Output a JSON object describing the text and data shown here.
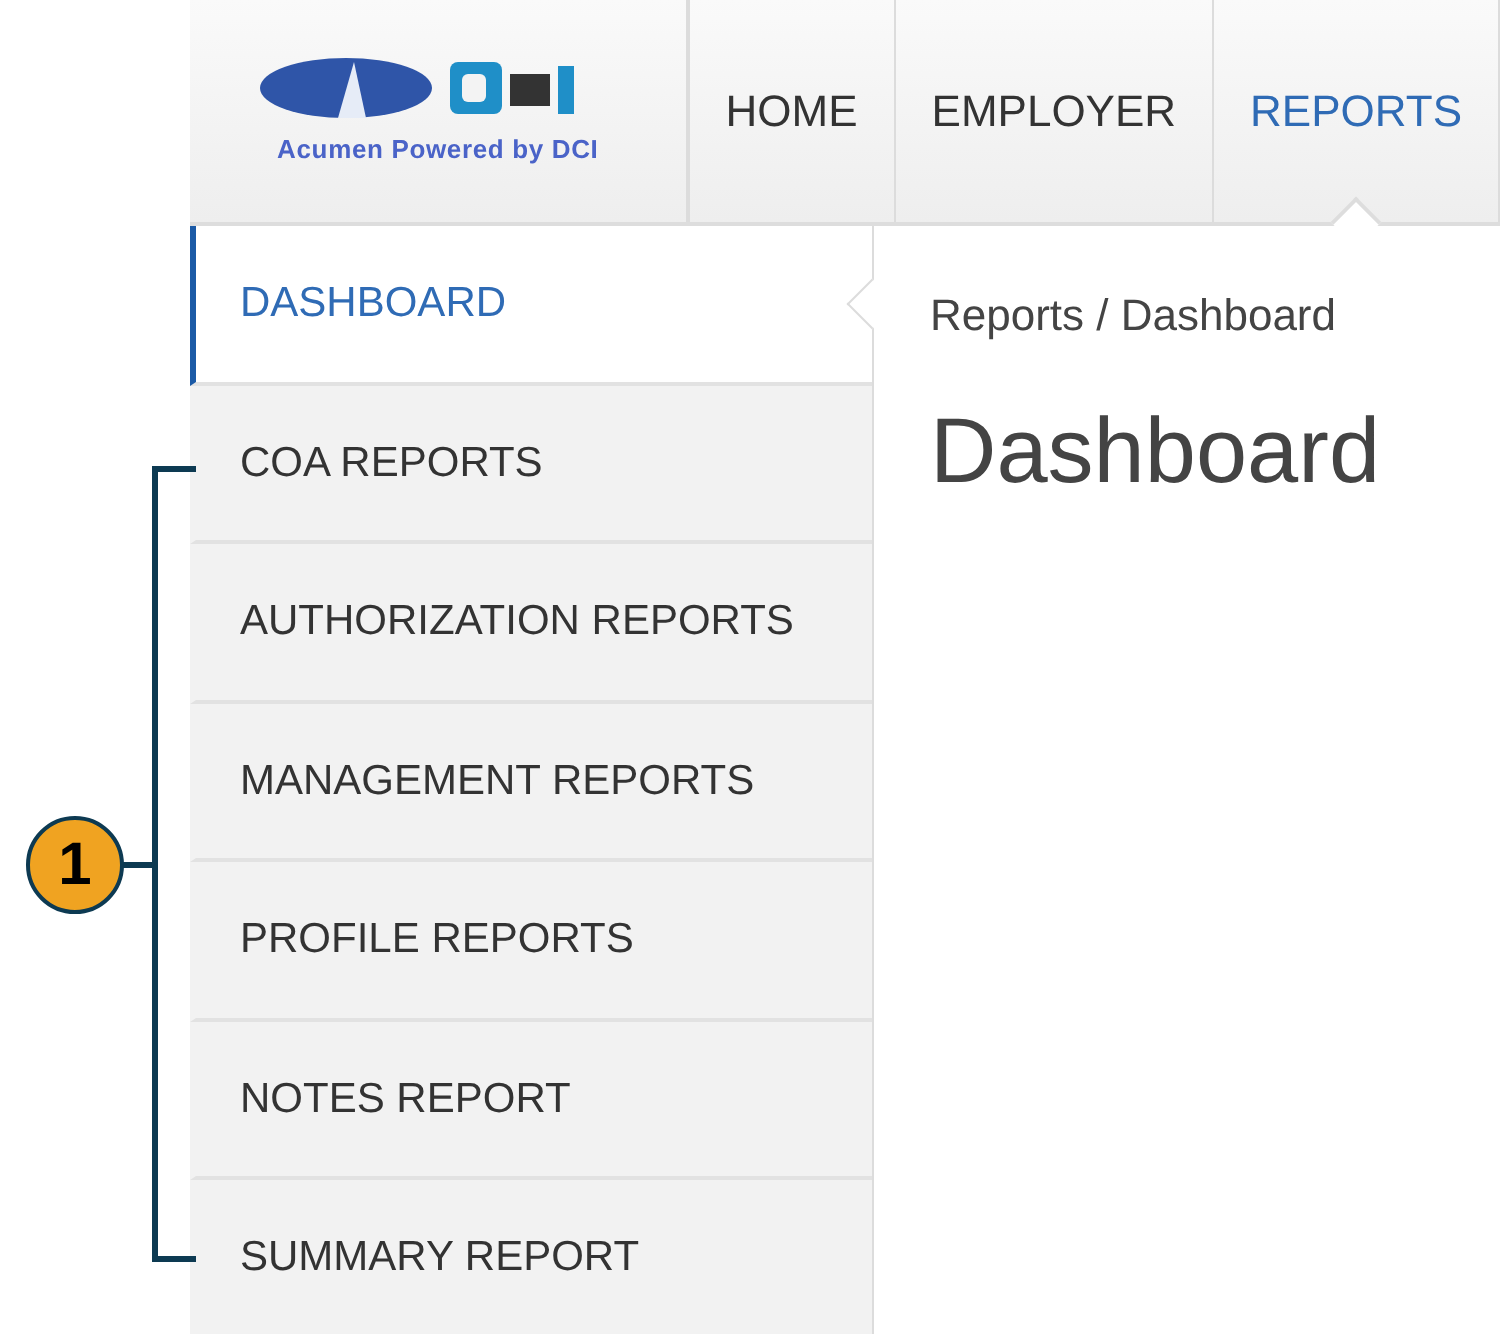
{
  "header": {
    "logo_text": "Acumen Powered by DCI"
  },
  "nav": [
    {
      "label": "HOME",
      "selected": false
    },
    {
      "label": "EMPLOYER",
      "selected": false
    },
    {
      "label": "REPORTS",
      "selected": true
    }
  ],
  "sidebar": {
    "items": [
      {
        "label": "DASHBOARD",
        "selected": true
      },
      {
        "label": "COA REPORTS",
        "selected": false
      },
      {
        "label": "AUTHORIZATION REPORTS",
        "selected": false
      },
      {
        "label": "MANAGEMENT REPORTS",
        "selected": false
      },
      {
        "label": "PROFILE REPORTS",
        "selected": false
      },
      {
        "label": "NOTES REPORT",
        "selected": false
      },
      {
        "label": "SUMMARY REPORT",
        "selected": false
      }
    ]
  },
  "breadcrumb": "Reports / Dashboard",
  "page_title": "Dashboard",
  "callout": {
    "number": "1"
  }
}
